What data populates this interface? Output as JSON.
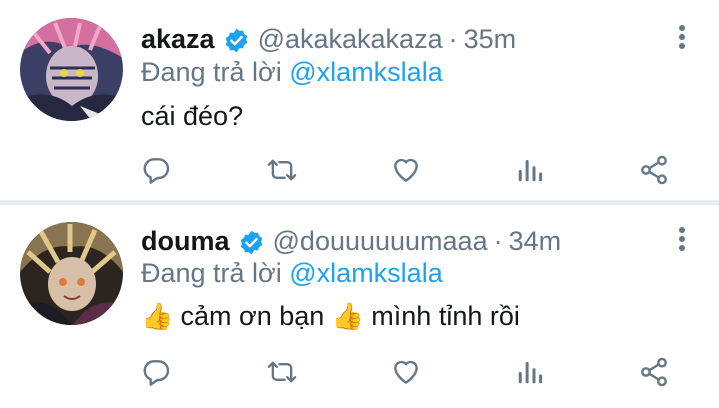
{
  "tweets": [
    {
      "name": "akaza",
      "handle": "@akakakakaza",
      "separator": "·",
      "time": "35m",
      "replying_prefix": "Đang trả lời ",
      "replying_to": "@xlamkslala",
      "text": "cái đéo?",
      "avatar_colors": [
        "#7a4c6e",
        "#2c2f55",
        "#d87aa8"
      ],
      "verified": true
    },
    {
      "name": "douma",
      "handle": "@douuuuuumaaa",
      "separator": "·",
      "time": "34m",
      "replying_prefix": "Đang trả lời ",
      "replying_to": "@xlamkslala",
      "text_parts": [
        "👍",
        " cảm ơn bạn ",
        "👍",
        " mình tỉnh rồi"
      ],
      "avatar_colors": [
        "#3a3128",
        "#c7a56a",
        "#1c1c24"
      ],
      "verified": true
    }
  ],
  "icons": {
    "verified": "verified-badge-icon",
    "more": "more-vertical-icon",
    "reply": "reply-icon",
    "retweet": "retweet-icon",
    "like": "heart-icon",
    "stats": "analytics-icon",
    "share": "share-icon"
  },
  "colors": {
    "accent": "#1da1f2",
    "secondary_text": "#657786",
    "primary_text": "#14171a",
    "divider": "#e9eef2"
  }
}
